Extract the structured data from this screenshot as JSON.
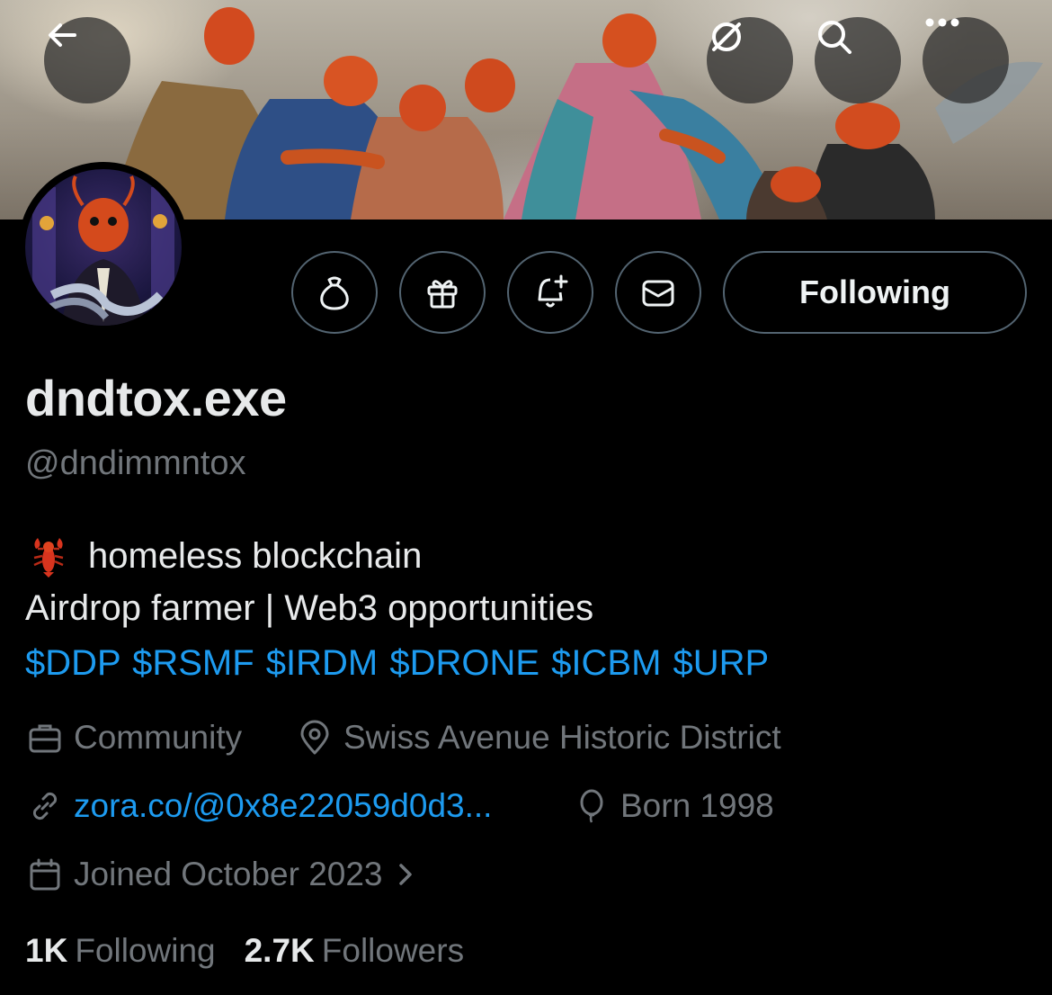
{
  "profile": {
    "display_name": "dndtox.exe",
    "handle": "@dndimmntox",
    "bio_line1": "homeless blockchain",
    "bio_line1_emoji": "lobster",
    "bio_line2": "Airdrop farmer | Web3 opportunities",
    "bio_line3": "$DDP $RSMF $IRDM $DRONE $ICBM $URP",
    "category": "Community",
    "location": "Swiss Avenue Historic District",
    "website": "zora.co/@0x8e22059d0d3...",
    "birth": "Born 1998",
    "joined": "Joined October 2023",
    "following_count": "1K",
    "following_label": "Following",
    "followers_count": "2.7K",
    "followers_label": "Followers"
  },
  "actions": {
    "follow_button_label": "Following",
    "icons": [
      "back-arrow-icon",
      "grok-icon",
      "search-icon",
      "more-icon",
      "money-bag-icon",
      "gift-icon",
      "bell-plus-icon",
      "message-icon"
    ]
  },
  "colors": {
    "background": "#000000",
    "text_primary": "#e7e9ea",
    "text_secondary": "#71767b",
    "link": "#1d9bf0",
    "border": "#536471"
  }
}
